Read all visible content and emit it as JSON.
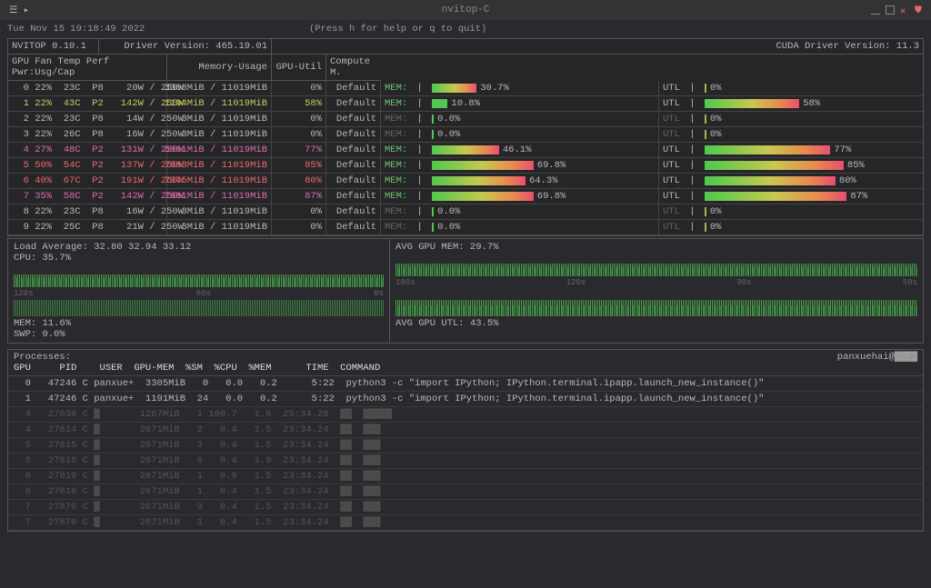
{
  "window": {
    "title": "nvitop-C",
    "left_icon": "☰ ▸"
  },
  "topline": {
    "timestamp": "Tue Nov 15 19:18:49 2022",
    "help": "(Press h for help or q to quit)"
  },
  "header": {
    "product": "NVITOP 0.10.1",
    "driver": "Driver Version: 465.19.01",
    "cuda": "CUDA Driver Version: 11.3",
    "cols_left": "GPU Fan Temp Perf Pwr:Usg/Cap",
    "mem_label": "Memory-Usage",
    "util_label": "GPU-Util",
    "compute_label": "Compute M."
  },
  "gpus": [
    {
      "idx": "0",
      "fan": "22%",
      "temp": "23C",
      "perf": "P8",
      "pwr": "20W / 250W",
      "mem": "3308MiB / 11019MiB",
      "util": "0%",
      "mode": "Default",
      "mem_pct": 30.7,
      "mem_label": "MEM:",
      "mem_text": "30.7%",
      "utl_label": "UTL",
      "utl_text": "0%",
      "style": "normal"
    },
    {
      "idx": "1",
      "fan": "22%",
      "temp": "43C",
      "perf": "P2",
      "pwr": "142W / 250W",
      "mem": "1194MiB / 11019MiB",
      "util": "58%",
      "mode": "Default",
      "mem_pct": 10.8,
      "mem_label": "MEM:",
      "mem_text": "10.8%",
      "utl_label": "UTL",
      "utl_text": "58%",
      "style": "yellow"
    },
    {
      "idx": "2",
      "fan": "22%",
      "temp": "23C",
      "perf": "P8",
      "pwr": "14W / 250W",
      "mem": "3MiB / 11019MiB",
      "util": "0%",
      "mode": "Default",
      "mem_pct": 0,
      "mem_label": "MEM:",
      "mem_text": "0.0%",
      "utl_label": "UTL",
      "utl_text": "0%",
      "style": "dim"
    },
    {
      "idx": "3",
      "fan": "22%",
      "temp": "26C",
      "perf": "P8",
      "pwr": "16W / 250W",
      "mem": "3MiB / 11019MiB",
      "util": "0%",
      "mode": "Default",
      "mem_pct": 0,
      "mem_label": "MEM:",
      "mem_text": "0.0%",
      "utl_label": "UTL",
      "utl_text": "0%",
      "style": "dim"
    },
    {
      "idx": "4",
      "fan": "27%",
      "temp": "48C",
      "perf": "P2",
      "pwr": "131W / 250W",
      "mem": "5061MiB / 11019MiB",
      "util": "77%",
      "mode": "Default",
      "mem_pct": 46.1,
      "mem_label": "MEM:",
      "mem_text": "46.1%",
      "utl_label": "UTL",
      "utl_text": "77%",
      "style": "magenta"
    },
    {
      "idx": "5",
      "fan": "50%",
      "temp": "54C",
      "perf": "P2",
      "pwr": "137W / 250W",
      "mem": "7683MiB / 11019MiB",
      "util": "85%",
      "mode": "Default",
      "mem_pct": 69.8,
      "mem_label": "MEM:",
      "mem_text": "69.8%",
      "utl_label": "UTL",
      "utl_text": "85%",
      "style": "red"
    },
    {
      "idx": "6",
      "fan": "40%",
      "temp": "67C",
      "perf": "P2",
      "pwr": "191W / 250W",
      "mem": "7075MiB / 11019MiB",
      "util": "80%",
      "mode": "Default",
      "mem_pct": 64.3,
      "mem_label": "MEM:",
      "mem_text": "64.3%",
      "utl_label": "UTL",
      "utl_text": "80%",
      "style": "red"
    },
    {
      "idx": "7",
      "fan": "35%",
      "temp": "58C",
      "perf": "P2",
      "pwr": "142W / 250W",
      "mem": "7681MiB / 11019MiB",
      "util": "87%",
      "mode": "Default",
      "mem_pct": 69.8,
      "mem_label": "MEM:",
      "mem_text": "69.8%",
      "utl_label": "UTL",
      "utl_text": "87%",
      "style": "magenta"
    },
    {
      "idx": "8",
      "fan": "22%",
      "temp": "23C",
      "perf": "P8",
      "pwr": "16W / 250W",
      "mem": "3MiB / 11019MiB",
      "util": "0%",
      "mode": "Default",
      "mem_pct": 0,
      "mem_label": "MEM:",
      "mem_text": "0.0%",
      "utl_label": "UTL",
      "utl_text": "0%",
      "style": "dim"
    },
    {
      "idx": "9",
      "fan": "22%",
      "temp": "25C",
      "perf": "P8",
      "pwr": "21W / 250W",
      "mem": "3MiB / 11019MiB",
      "util": "0%",
      "mode": "Default",
      "mem_pct": 0,
      "mem_label": "MEM:",
      "mem_text": "0.0%",
      "utl_label": "UTL",
      "utl_text": "0%",
      "style": "dim"
    }
  ],
  "system": {
    "load": "Load Average: 32.80 32.94 33.12",
    "cpu": "CPU: 35.7%",
    "mem": "MEM: 11.6%",
    "swp": "SWP: 0.0%",
    "timeline_left": [
      "120s",
      "60s",
      "0s"
    ],
    "avg_gpu_mem": "AVG GPU MEM: 29.7%",
    "avg_gpu_utl": "AVG GPU UTL: 43.5%",
    "timeline_right": [
      "180s",
      "120s",
      "90s",
      "50s"
    ]
  },
  "processes": {
    "title": "Processes:",
    "user_host": "panxuehai@▓▓▓▓",
    "columns": "GPU     PID    USER  GPU-MEM  %SM  %CPU  %MEM      TIME  COMMAND",
    "rows": [
      {
        "text": "  0   47246 C panxue+  3305MiB   0   0.0   0.2      5:22  python3 -c \"import IPython; IPython.terminal.ipapp.launch_new_instance()\"",
        "dim": false
      },
      {
        "text": "  1   47246 C panxue+  1191MiB  24   0.0   0.2      5:22  python3 -c \"import IPython; IPython.terminal.ipapp.launch_new_instance()\"",
        "dim": false
      },
      {
        "text": "  4   27638 C ▓       1267MiB   1 100.7   1.8  25:34.28  ▓▓  ▓▓▓▓▓",
        "dim": true
      },
      {
        "text": "  4   27814 C ▓       2671MiB   2   0.4   1.5  23:34.24  ▓▓  ▓▓▓",
        "dim": true
      },
      {
        "text": "  5   27815 C ▓       2671MiB   3   0.4   1.5  23:34.24  ▓▓  ▓▓▓",
        "dim": true
      },
      {
        "text": "  5   27816 C ▓       2671MiB   8   0.4   1.9  23:34.24  ▓▓  ▓▓▓",
        "dim": true
      },
      {
        "text": "  6   27819 C ▓       2671MiB   1   0.9   1.5  23:34.24  ▓▓  ▓▓▓",
        "dim": true
      },
      {
        "text": "  6   27818 C ▓       2671MiB   1   0.4   1.5  23:34.24  ▓▓  ▓▓▓",
        "dim": true
      },
      {
        "text": "  7   27870 C ▓       2671MiB   9   0.4   1.5  23:34.24  ▓▓  ▓▓▓",
        "dim": true
      },
      {
        "text": "  7   27870 C ▓       2671MiB   1   0.4   1.5  23:34.24  ▓▓  ▓▓▓",
        "dim": true
      }
    ]
  }
}
